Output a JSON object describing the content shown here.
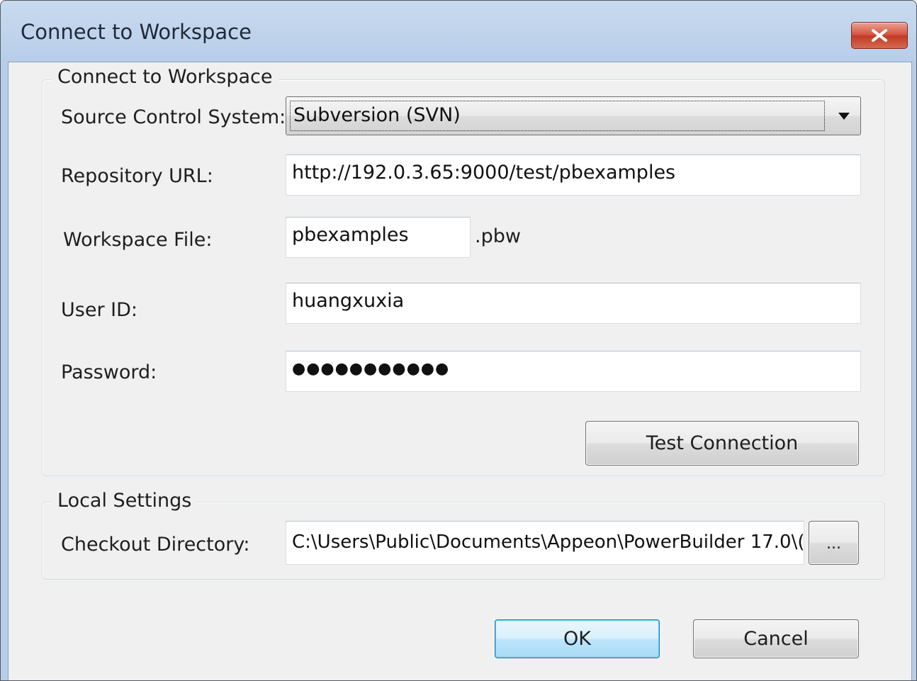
{
  "window": {
    "title": "Connect to Workspace",
    "close_icon": "close-icon"
  },
  "workspace_group": {
    "legend": "Connect to Workspace",
    "source_control_label": "Source Control System:",
    "source_control_value": "Subversion (SVN)",
    "repository_url_label": "Repository URL:",
    "repository_url_value": "http://192.0.3.65:9000/test/pbexamples",
    "workspace_file_label": "Workspace File:",
    "workspace_file_value": "pbexamples",
    "workspace_file_ext": ".pbw",
    "user_id_label": "User ID:",
    "user_id_value": "huangxuxia",
    "password_label": "Password:",
    "password_value": "●●●●●●●●●●●",
    "test_connection_label": "Test Connection"
  },
  "local_group": {
    "legend": "Local Settings",
    "checkout_dir_label": "Checkout Directory:",
    "checkout_dir_value": "C:\\Users\\Public\\Documents\\Appeon\\PowerBuilder 17.0\\(",
    "browse_label": "..."
  },
  "footer": {
    "ok_label": "OK",
    "cancel_label": "Cancel"
  },
  "colors": {
    "title_bar": "#c9daef",
    "close_button": "#c94a33",
    "dialog_bg": "#f0f0f0",
    "default_button_border": "#3c7fb1"
  }
}
